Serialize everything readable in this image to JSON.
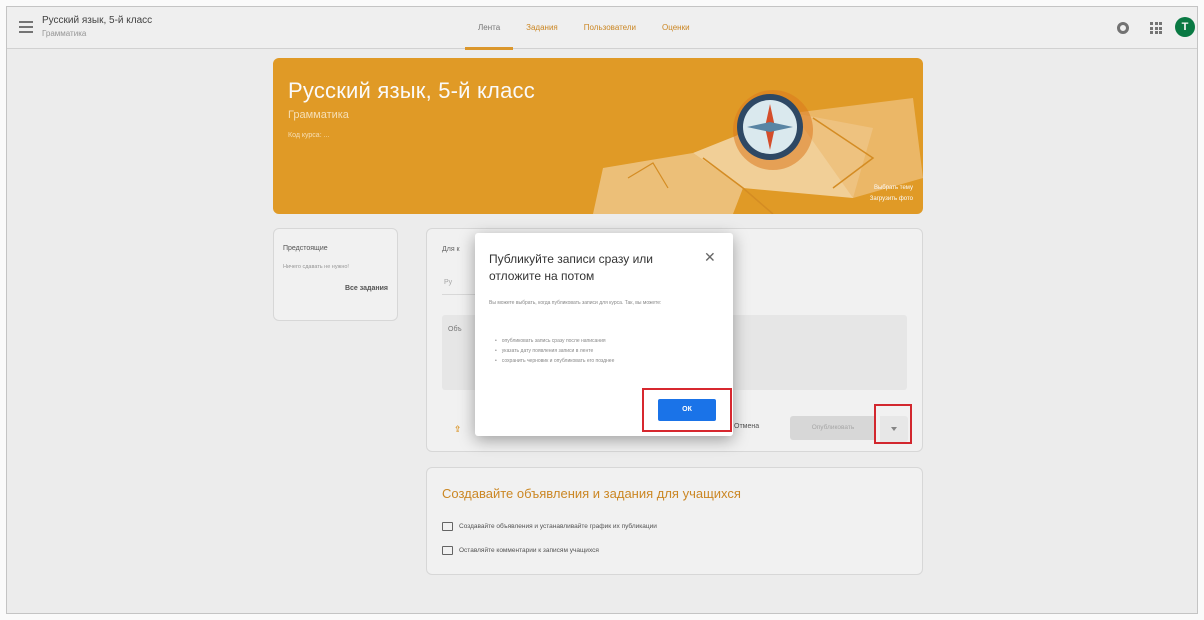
{
  "header": {
    "course_title": "Русский язык, 5-й класс",
    "course_subtitle": "Грамматика",
    "tabs": [
      {
        "label": "Лента",
        "active": true
      },
      {
        "label": "Задания",
        "active": false
      },
      {
        "label": "Пользователи",
        "active": false
      },
      {
        "label": "Оценки",
        "active": false
      }
    ],
    "avatar_letter": "Т",
    "icons": [
      "menu-icon",
      "gear-icon",
      "apps-icon"
    ]
  },
  "banner": {
    "title": "Русский язык, 5-й класс",
    "subtitle": "Грамматика",
    "class_code": "Код курса: ...",
    "select_theme": "Выбрать тему",
    "upload_photo": "Загрузить фото",
    "color": "#e59e27"
  },
  "upcoming": {
    "title": "Предстоящие",
    "text": "Ничего сдавать не нужно!",
    "link": "Все задания"
  },
  "post": {
    "for_label": "Для к",
    "field_text": "Ру",
    "area_text": "Объ",
    "cancel_label": "Отмена",
    "publish_label": "Опубликовать"
  },
  "create": {
    "title": "Создавайте объявления и задания для учащихся",
    "row1": "Создавайте объявления и устанавливайте график их публикации",
    "row2": "Оставляйте комментарии к записям учащихся"
  },
  "dialog": {
    "title": "Публикуйте записи сразу или отложите на потом",
    "body": "Вы можете выбрать, когда публиковать записи для курса. Так, вы можете:",
    "items": [
      "опубликовать запись сразу после написания",
      "указать дату появления записи в ленте",
      "сохранить черновик и опубликовать его позднее"
    ],
    "ok_label": "ОК",
    "close_icon": "close-icon",
    "accent": "#1a73e8"
  },
  "highlight_color": "#d7282f"
}
